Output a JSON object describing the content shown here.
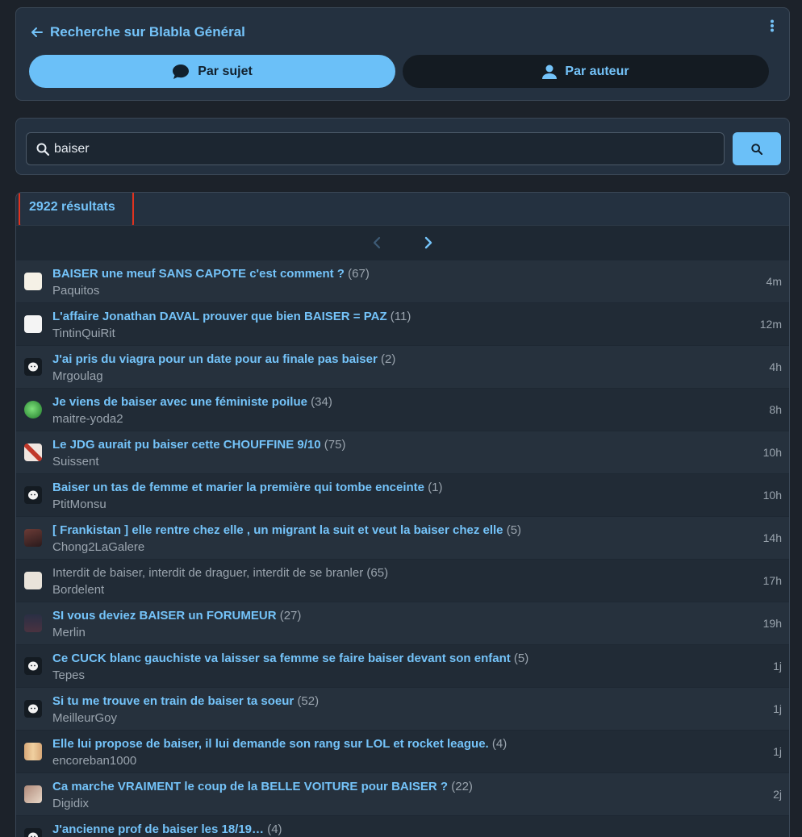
{
  "header": {
    "title": "Recherche sur Blabla Général",
    "tab_subject": "Par sujet",
    "tab_author": "Par auteur"
  },
  "search": {
    "value": "baiser"
  },
  "results": {
    "count_label": "2922 résultats",
    "items": [
      {
        "title": "BAISER une meuf SANS CAPOTE c'est comment ?",
        "count": "(67)",
        "author": "Paquitos",
        "time": "4m",
        "avatar": "mask-avatar"
      },
      {
        "title": "L'affaire Jonathan DAVAL prouver que bien BAISER = PAZ",
        "count": "(11)",
        "author": "TintinQuiRit",
        "time": "12m",
        "avatar": "red-emblem-avatar"
      },
      {
        "title": "J'ai pris du viagra pour un date pour au finale pas baiser",
        "count": "(2)",
        "author": "Mrgoulag",
        "time": "4h",
        "avatar": "default-avatar"
      },
      {
        "title": "Je viens de baiser avec une féministe poilue",
        "count": "(34)",
        "author": "maitre-yoda2",
        "time": "8h",
        "avatar": "green-avatar"
      },
      {
        "title": "Le JDG aurait pu baiser cette CHOUFFINE 9/10",
        "count": "(75)",
        "author": "Suissent",
        "time": "10h",
        "avatar": "cross-avatar"
      },
      {
        "title": "Baiser un tas de femme et marier la première qui tombe enceinte",
        "count": "(1)",
        "author": "PtitMonsu",
        "time": "10h",
        "avatar": "default-avatar"
      },
      {
        "title": "[ Frankistan ] elle rentre chez elle , un migrant la suit et veut la baiser chez elle",
        "count": "(5)",
        "author": "Chong2LaGalere",
        "time": "14h",
        "avatar": "portrait-avatar"
      },
      {
        "title": "Interdit de baiser, interdit de draguer, interdit de se branler",
        "count": "(65)",
        "author": "Bordelent",
        "time": "17h",
        "avatar": "cat-avatar",
        "visited": true
      },
      {
        "title": "SI vous deviez BAISER un FORUMEUR",
        "count": "(27)",
        "author": "Merlin",
        "time": "19h",
        "avatar": "dark-avatar"
      },
      {
        "title": "Ce CUCK blanc gauchiste va laisser sa femme se faire baiser devant son enfant",
        "count": "(5)",
        "author": "Tepes",
        "time": "1j",
        "avatar": "default-avatar"
      },
      {
        "title": "Si tu me trouve en train de baiser ta soeur",
        "count": "(52)",
        "author": "MeilleurGoy",
        "time": "1j",
        "avatar": "default-avatar"
      },
      {
        "title": "Elle lui propose de baiser, il lui demande son rang sur LOL et rocket league.",
        "count": "(4)",
        "author": "encoreban1000",
        "time": "1j",
        "avatar": "legs-avatar"
      },
      {
        "title": "Ca marche VRAIMENT le coup de la BELLE VOITURE pour BAISER ?",
        "count": "(22)",
        "author": "Digidix",
        "time": "2j",
        "avatar": "photo-avatar"
      },
      {
        "title": "J'ancienne prof de baiser les 18/19…",
        "count": "(4)",
        "author": "",
        "time": "",
        "avatar": "default-avatar"
      }
    ]
  },
  "colors": {
    "accent": "#74c3f9",
    "button": "#6bc0f8",
    "card": "#243140",
    "background": "#1c222a",
    "highlight": "#e0331f"
  }
}
